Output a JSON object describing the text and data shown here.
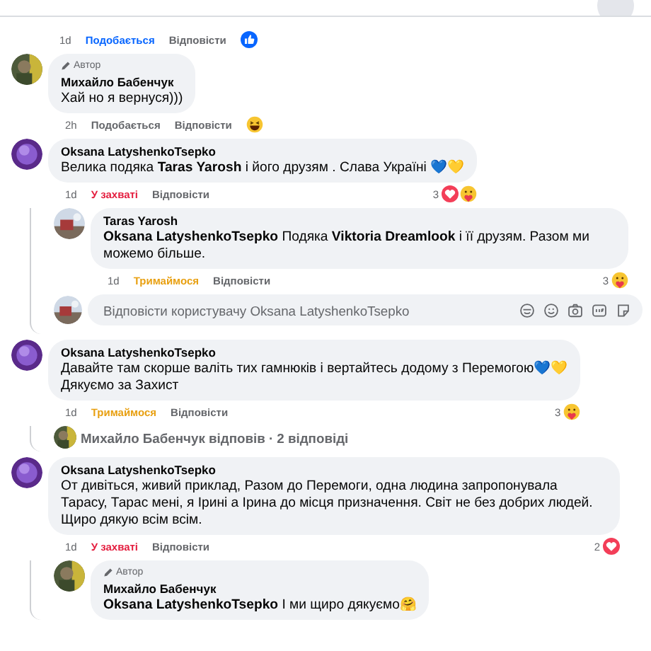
{
  "top_actions": {
    "time": "1d",
    "reaction": {
      "label": "Подобається",
      "kind": "like"
    },
    "reply_label": "Відповісти",
    "summary": {
      "kind": "inline",
      "reactions": [
        {
          "kind": "like"
        }
      ]
    }
  },
  "comments": [
    {
      "avatar": {
        "kind": "soldier"
      },
      "author_badge": "Автор",
      "author": "Михайло Бабенчук",
      "text": "Хай но я вернуся)))",
      "actions": {
        "time": "2h",
        "reaction": {
          "label": "Подобається",
          "kind": "none"
        },
        "reply_label": "Відповісти",
        "summary": {
          "kind": "inline",
          "reactions": [
            {
              "kind": "haha"
            }
          ]
        }
      }
    },
    {
      "avatar": {
        "kind": "purple"
      },
      "author": "Oksana LatyshenkoTsepko",
      "text": "Велика подяка **Taras Yarosh** і його друзям . Слава Україні 💙💛",
      "actions": {
        "time": "1d",
        "reaction": {
          "label": "У захваті",
          "kind": "love"
        },
        "reply_label": "Відповісти",
        "summary": {
          "kind": "end",
          "count": "3",
          "reactions": [
            {
              "kind": "love"
            },
            {
              "kind": "care"
            }
          ]
        }
      },
      "replies": [
        {
          "avatar": {
            "kind": "landscape"
          },
          "author": "Taras Yarosh",
          "text": "**Oksana LatyshenkoTsepko** Подяка **Viktoria Dreamlook** і її друзям. Разом ми можемо більше.",
          "actions": {
            "time": "1d",
            "reaction": {
              "label": "Тримаймося",
              "kind": "care"
            },
            "reply_label": "Відповісти",
            "summary": {
              "kind": "end",
              "count": "3",
              "reactions": [
                {
                  "kind": "care"
                }
              ]
            }
          }
        }
      ],
      "reply_field": {
        "avatar": {
          "kind": "landscape"
        },
        "placeholder": "Відповісти користувачу Oksana LatyshenkoTsepko"
      }
    },
    {
      "avatar": {
        "kind": "purple"
      },
      "author": "Oksana LatyshenkoTsepko",
      "text": "Давайте там скорше валіть тих гамнюків і вертайтесь додому з Перемогою💙💛\nДякуємо за Захист",
      "actions": {
        "time": "1d",
        "reaction": {
          "label": "Тримаймося",
          "kind": "care"
        },
        "reply_label": "Відповісти",
        "summary": {
          "kind": "end",
          "count": "3",
          "reactions": [
            {
              "kind": "care"
            }
          ]
        }
      },
      "replies_link": {
        "avatar": {
          "kind": "soldier"
        },
        "text": "Михайло Бабенчук відповів · 2 відповіді"
      }
    },
    {
      "avatar": {
        "kind": "purple"
      },
      "author": "Oksana LatyshenkoTsepko",
      "text": "От дивіться, живий приклад, Разом до Перемоги, одна людина запропонувала Тарасу, Тарас мені, я Ірині а Ірина до місця призначення. Світ не без добрих людей. Щиро дякую всім всім.",
      "actions": {
        "time": "1d",
        "reaction": {
          "label": "У захваті",
          "kind": "love"
        },
        "reply_label": "Відповісти",
        "summary": {
          "kind": "end",
          "count": "2",
          "reactions": [
            {
              "kind": "love"
            }
          ]
        }
      },
      "replies": [
        {
          "avatar": {
            "kind": "soldier"
          },
          "author_badge": "Автор",
          "author": "Михайло Бабенчук",
          "text": "**Oksana LatyshenkoTsepko** І ми щиро дякуємо🤗"
        }
      ]
    }
  ]
}
